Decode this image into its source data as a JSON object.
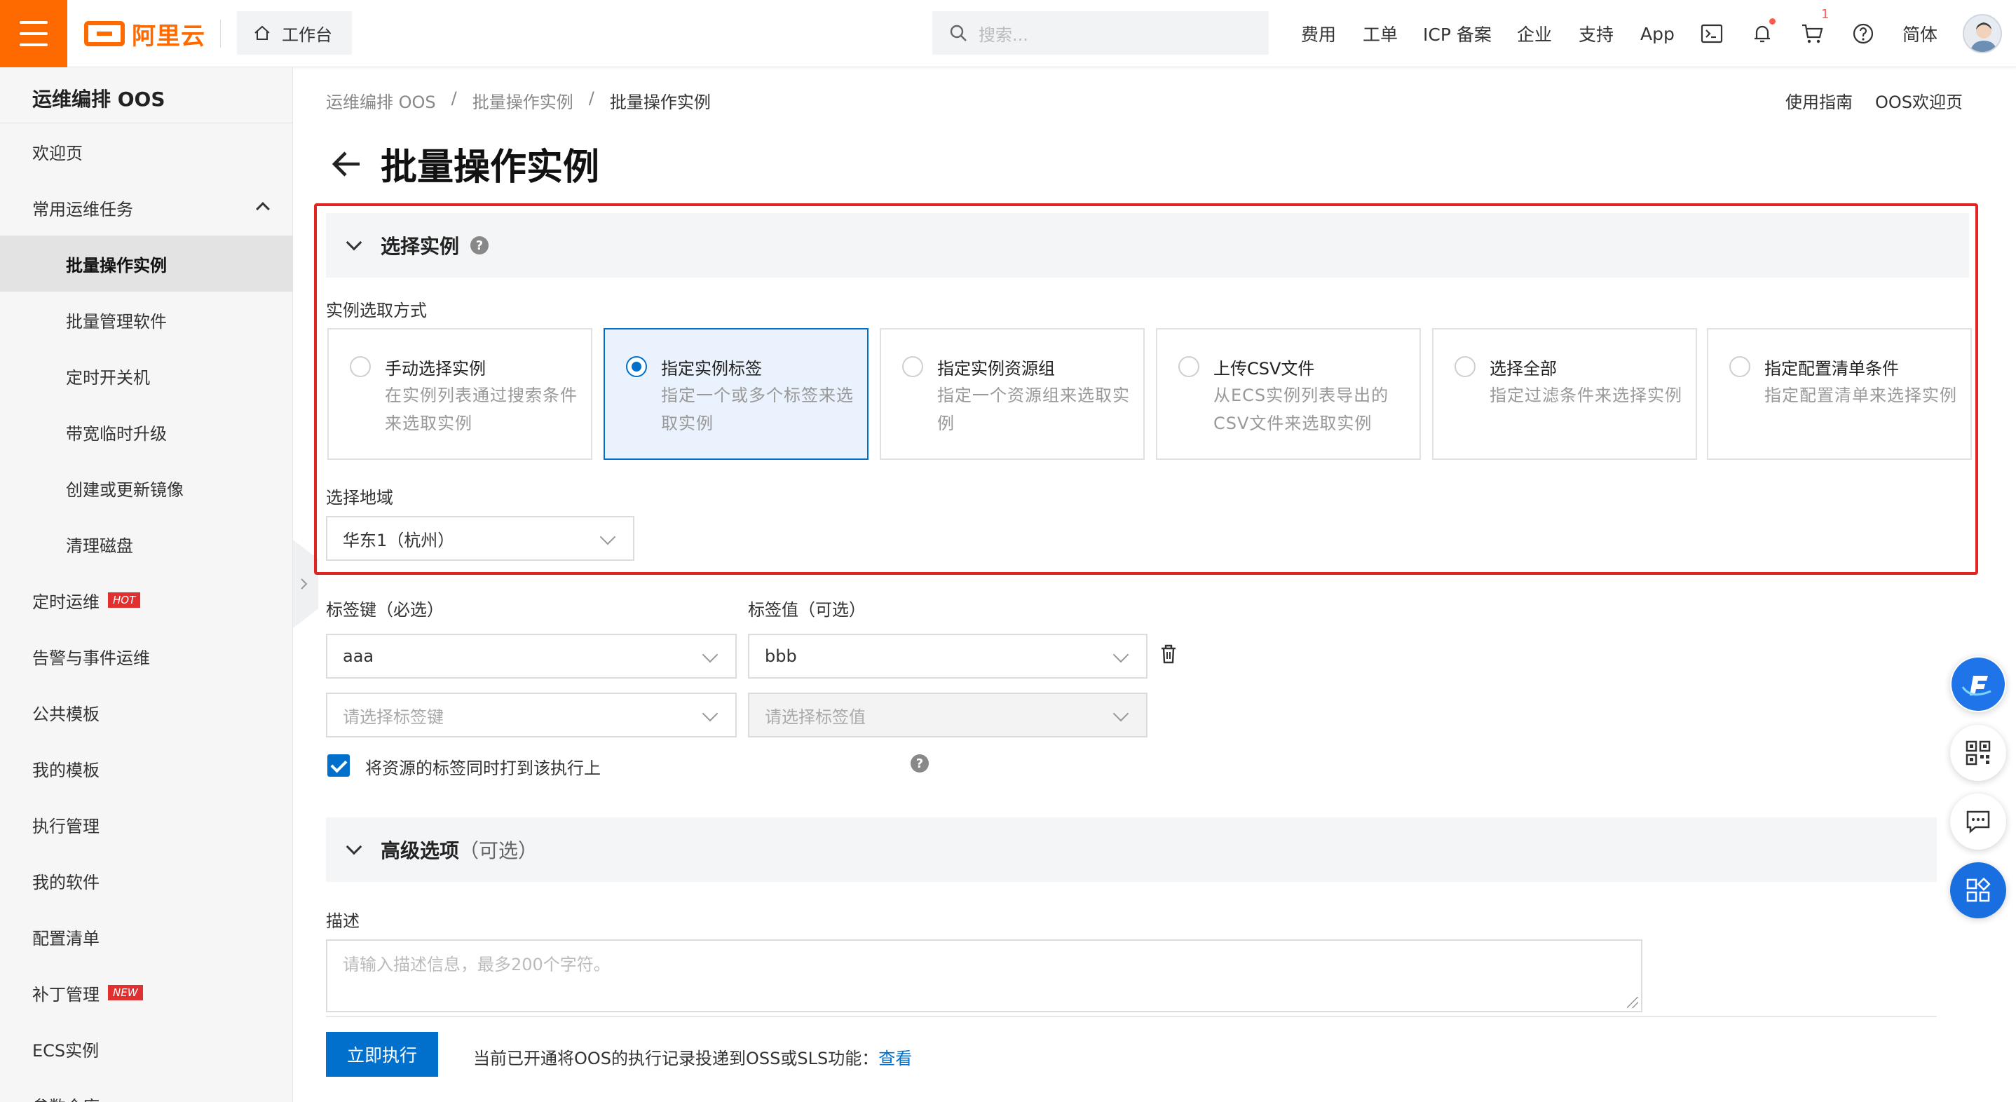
{
  "topbar": {
    "logo_text": "阿里云",
    "workbench_label": "工作台",
    "search_placeholder": "搜索...",
    "nav": [
      "费用",
      "工单",
      "ICP 备案",
      "企业",
      "支持",
      "App"
    ],
    "cart_count": "1",
    "language": "简体"
  },
  "sidebar": {
    "title": "运维编排 OOS",
    "items": [
      {
        "label": "欢迎页"
      },
      {
        "label": "常用运维任务"
      },
      {
        "label": "批量操作实例"
      },
      {
        "label": "批量管理软件"
      },
      {
        "label": "定时开关机"
      },
      {
        "label": "带宽临时升级"
      },
      {
        "label": "创建或更新镜像"
      },
      {
        "label": "清理磁盘"
      },
      {
        "label": "定时运维",
        "tag": "HOT"
      },
      {
        "label": "告警与事件运维"
      },
      {
        "label": "公共模板"
      },
      {
        "label": "我的模板"
      },
      {
        "label": "执行管理"
      },
      {
        "label": "我的软件"
      },
      {
        "label": "配置清单"
      },
      {
        "label": "补丁管理",
        "tag": "NEW"
      },
      {
        "label": "ECS实例"
      },
      {
        "label": "参数仓库"
      }
    ]
  },
  "breadcrumb": [
    "运维编排 OOS",
    "/",
    "批量操作实例",
    "/",
    "批量操作实例"
  ],
  "help_links": [
    "使用指南",
    "OOS欢迎页"
  ],
  "page_title": "批量操作实例",
  "select_section": {
    "title": "选择实例",
    "mode_label": "实例选取方式",
    "options": [
      {
        "title": "手动选择实例",
        "desc": "在实例列表通过搜索条件来选取实例",
        "selected": false
      },
      {
        "title": "指定实例标签",
        "desc": "指定一个或多个标签来选取实例",
        "selected": true
      },
      {
        "title": "指定实例资源组",
        "desc": "指定一个资源组来选取实例",
        "selected": false
      },
      {
        "title": "上传CSV文件",
        "desc": "从ECS实例列表导出的CSV文件来选取实例",
        "selected": false
      },
      {
        "title": "选择全部",
        "desc": "指定过滤条件来选择实例",
        "selected": false
      },
      {
        "title": "指定配置清单条件",
        "desc": "指定配置清单来选择实例",
        "selected": false
      }
    ],
    "region_label": "选择地域",
    "region_value": "华东1（杭州）"
  },
  "tags": {
    "key_label": "标签键（必选）",
    "value_label": "标签值（可选）",
    "rows": [
      {
        "key": "aaa",
        "value": "bbb"
      }
    ],
    "key_placeholder": "请选择标签键",
    "value_placeholder": "请选择标签值",
    "propagate_label": "将资源的标签同时打到该执行上",
    "propagate_checked": true
  },
  "advanced": {
    "title": "高级选项",
    "optional": "（可选）"
  },
  "description": {
    "label": "描述",
    "placeholder": "请输入描述信息，最多200个字符。"
  },
  "footer": {
    "run_label": "立即执行",
    "notice": "当前已开通将OOS的执行记录投递到OSS或SLS功能：",
    "notice_link": "查看"
  },
  "colors": {
    "brand": "#ff6a00",
    "primary": "#0070cc",
    "highlight_border": "#e0241f"
  }
}
